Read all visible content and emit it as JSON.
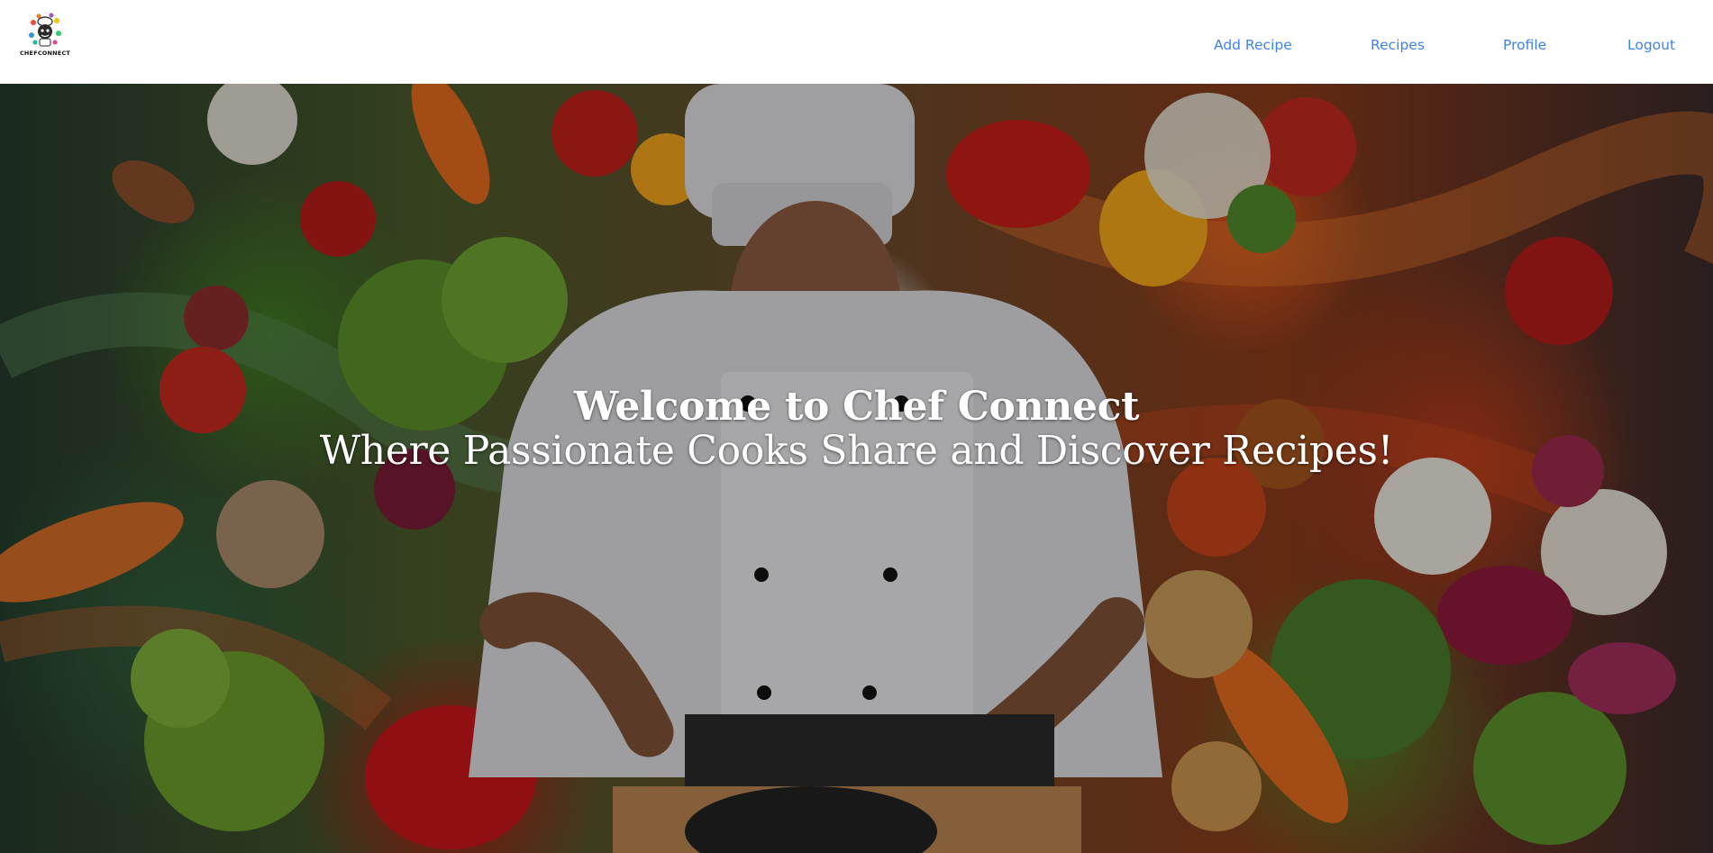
{
  "brand": {
    "logo_text": "CHEFCONNECT"
  },
  "nav": {
    "items": [
      {
        "label": "Add Recipe"
      },
      {
        "label": "Recipes"
      },
      {
        "label": "Profile"
      },
      {
        "label": "Logout"
      }
    ],
    "link_color": "#3f82e6"
  },
  "hero": {
    "title": "Welcome to Chef Connect",
    "subtitle": "Where Passionate Cooks Share and Discover Recipes!",
    "background_image": "chef cooking surrounded by colorful vegetables"
  }
}
